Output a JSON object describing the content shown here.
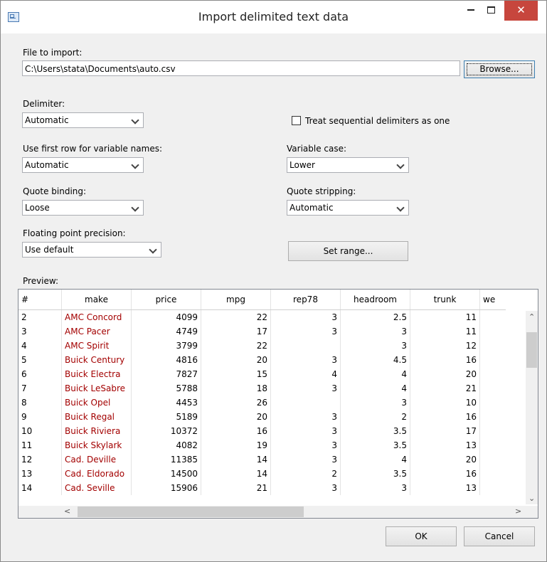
{
  "window": {
    "title": "Import delimited text data",
    "close_glyph": "✕"
  },
  "file": {
    "label": "File to import:",
    "value": "C:\\Users\\stata\\Documents\\auto.csv",
    "browse_label": "Browse..."
  },
  "delimiter": {
    "label": "Delimiter:",
    "value": "Automatic"
  },
  "sequential": {
    "label": "Treat sequential delimiters as one",
    "checked": false
  },
  "first_row": {
    "label": "Use first row for variable names:",
    "value": "Automatic"
  },
  "variable_case": {
    "label": "Variable case:",
    "value": "Lower"
  },
  "quote_binding": {
    "label": "Quote binding:",
    "value": "Loose"
  },
  "quote_stripping": {
    "label": "Quote stripping:",
    "value": "Automatic"
  },
  "float_precision": {
    "label": "Floating point precision:",
    "value": "Use default"
  },
  "set_range_label": "Set range...",
  "preview": {
    "label": "Preview:",
    "columns": [
      "#",
      "make",
      "price",
      "mpg",
      "rep78",
      "headroom",
      "trunk",
      "we"
    ],
    "rows": [
      [
        "2",
        "AMC Concord",
        "4099",
        "22",
        "3",
        "2.5",
        "11"
      ],
      [
        "3",
        "AMC Pacer",
        "4749",
        "17",
        "3",
        "3",
        "11"
      ],
      [
        "4",
        "AMC Spirit",
        "3799",
        "22",
        "",
        "3",
        "12"
      ],
      [
        "5",
        "Buick Century",
        "4816",
        "20",
        "3",
        "4.5",
        "16"
      ],
      [
        "6",
        "Buick Electra",
        "7827",
        "15",
        "4",
        "4",
        "20"
      ],
      [
        "7",
        "Buick LeSabre",
        "5788",
        "18",
        "3",
        "4",
        "21"
      ],
      [
        "8",
        "Buick Opel",
        "4453",
        "26",
        "",
        "3",
        "10"
      ],
      [
        "9",
        "Buick Regal",
        "5189",
        "20",
        "3",
        "2",
        "16"
      ],
      [
        "10",
        "Buick Riviera",
        "10372",
        "16",
        "3",
        "3.5",
        "17"
      ],
      [
        "11",
        "Buick Skylark",
        "4082",
        "19",
        "3",
        "3.5",
        "13"
      ],
      [
        "12",
        "Cad. Deville",
        "11385",
        "14",
        "3",
        "4",
        "20"
      ],
      [
        "13",
        "Cad. Eldorado",
        "14500",
        "14",
        "2",
        "3.5",
        "16"
      ],
      [
        "14",
        "Cad. Seville",
        "15906",
        "21",
        "3",
        "3",
        "13"
      ]
    ]
  },
  "ok_label": "OK",
  "cancel_label": "Cancel",
  "colors": {
    "make_text": "#a30000",
    "close_button": "#c7463d"
  }
}
